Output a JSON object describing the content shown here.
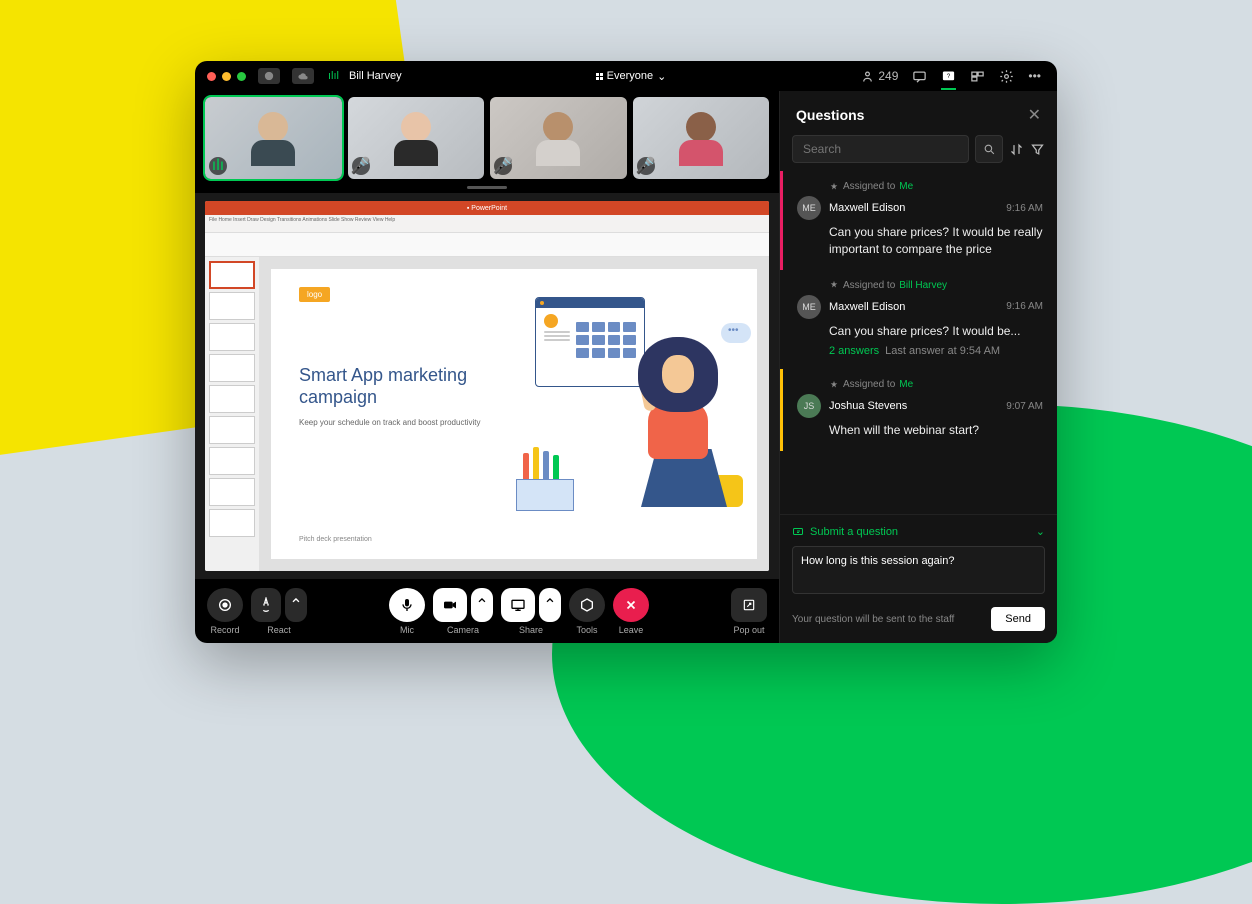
{
  "host_name": "Bill Harvey",
  "view_mode": "Everyone",
  "participant_count": "249",
  "ppt": {
    "logo": "logo",
    "title": "Smart App marketing campaign",
    "subtitle": "Keep your schedule on track and boost productivity",
    "footer": "Pitch deck presentation"
  },
  "toolbar": {
    "record": "Record",
    "react": "React",
    "mic": "Mic",
    "camera": "Camera",
    "share": "Share",
    "tools": "Tools",
    "leave": "Leave",
    "popout": "Pop out"
  },
  "panel": {
    "title": "Questions",
    "search_placeholder": "Search",
    "submit_label": "Submit a question",
    "note": "Your question will be sent to the staff",
    "send": "Send",
    "draft": "How long is this session again?"
  },
  "questions": [
    {
      "assigned_label": "Assigned to",
      "assigned_to": "Me",
      "avatar": "ME",
      "name": "Maxwell Edison",
      "time": "9:16 AM",
      "text": "Can you share prices? It would be really important to compare the price"
    },
    {
      "assigned_label": "Assigned to",
      "assigned_to": "Bill Harvey",
      "avatar": "ME",
      "name": "Maxwell Edison",
      "time": "9:16 AM",
      "text": "Can you share prices? It would be...",
      "answers": "2 answers",
      "last_answer": "Last answer at 9:54 AM"
    },
    {
      "assigned_label": "Assigned to",
      "assigned_to": "Me",
      "avatar": "JS",
      "avatar_color": "#4b7a55",
      "name": "Joshua Stevens",
      "time": "9:07 AM",
      "text": "When will the webinar start?"
    }
  ]
}
